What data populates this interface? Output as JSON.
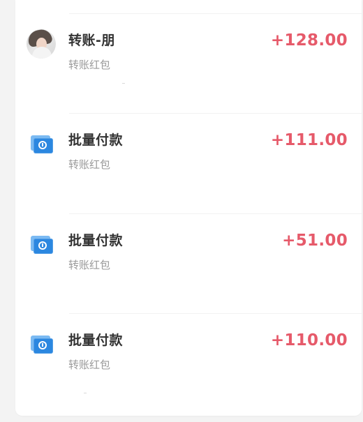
{
  "transactions": [
    {
      "title": "转账-朋",
      "subtitle": "转账红包",
      "amount": "+128.00",
      "icon": "avatar-icon"
    },
    {
      "title": "批量付款",
      "subtitle": "转账红包",
      "amount": "+111.00",
      "icon": "batch-payment-icon"
    },
    {
      "title": "批量付款",
      "subtitle": "转账红包",
      "amount": "+51.00",
      "icon": "batch-payment-icon"
    },
    {
      "title": "批量付款",
      "subtitle": "转账红包",
      "amount": "+110.00",
      "icon": "batch-payment-icon"
    }
  ],
  "colors": {
    "background": "#f3f3f3",
    "card": "#ffffff",
    "primary_text": "#333333",
    "secondary_text": "#9a9a9a",
    "amount_text": "#e65a6a",
    "batch_payment_icon": "#2b87e0"
  }
}
